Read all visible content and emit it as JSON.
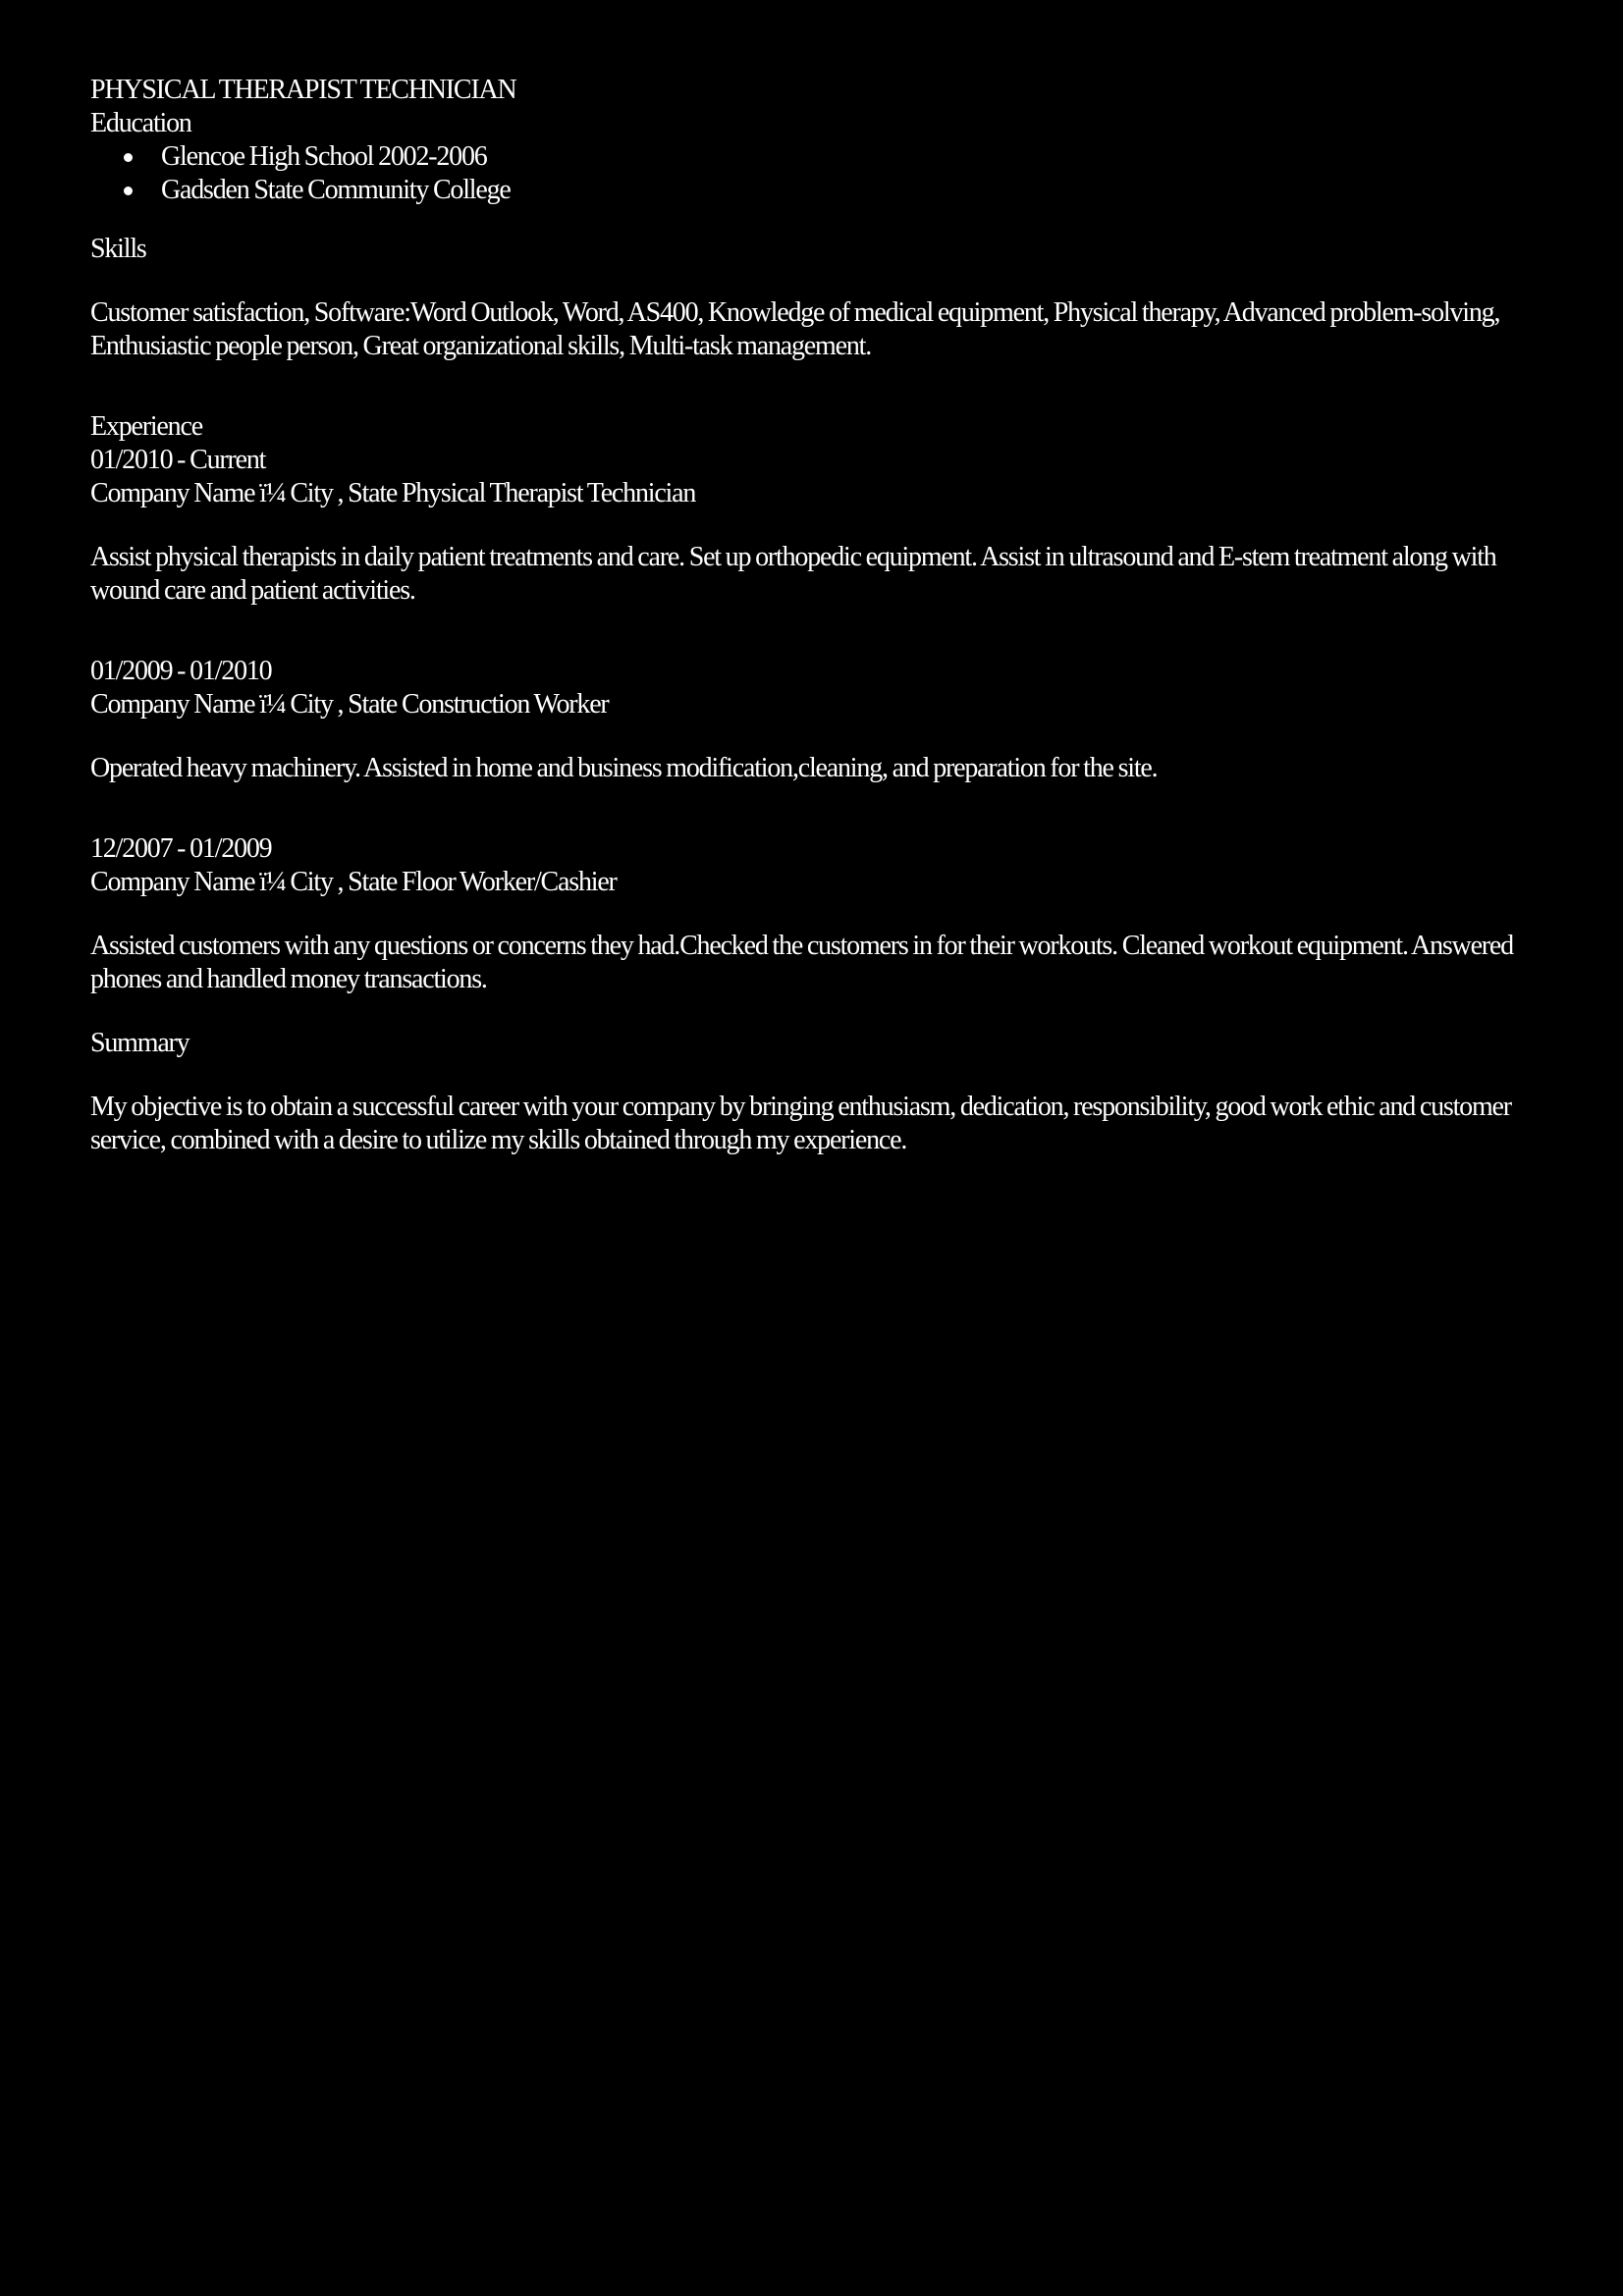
{
  "title": "PHYSICAL THERAPIST TECHNICIAN",
  "education": {
    "heading": "Education",
    "items": [
      "Glencoe High School 2002-2006",
      "Gadsden State Community College"
    ]
  },
  "skills": {
    "heading": "Skills",
    "text": "Customer satisfaction, Software:Word Outlook, Word, AS400, Knowledge of medical equipment, Physical therapy, Advanced problem-solving, Enthusiastic people person, Great organizational skills, Multi-task management."
  },
  "experience": {
    "heading": "Experience",
    "jobs": [
      {
        "dates": "01/2010 - Current",
        "company_line": "Company Name ï¼ City , State Physical Therapist Technician",
        "description": "Assist physical therapists in daily patient treatments and care. Set up orthopedic equipment. Assist in ultrasound and E-stem treatment along with wound care and patient activities."
      },
      {
        "dates": "01/2009 - 01/2010",
        "company_line": "Company Name ï¼ City , State Construction Worker",
        "description": "Operated heavy machinery. Assisted in home and business modification,cleaning, and preparation for the site."
      },
      {
        "dates": "12/2007 - 01/2009",
        "company_line": "Company Name ï¼ City , State Floor Worker/Cashier",
        "description": "Assisted customers with any questions or concerns they had.Checked the customers in for their workouts. Cleaned workout equipment. Answered phones and handled money transactions."
      }
    ]
  },
  "summary": {
    "heading": "Summary",
    "text": "My objective is to obtain a successful career with your company by bringing enthusiasm, dedication, responsibility, good work ethic and customer service, combined with a desire to utilize my skills obtained through my experience."
  },
  "colors": {
    "background": "#000000",
    "text": "#ffffff"
  }
}
